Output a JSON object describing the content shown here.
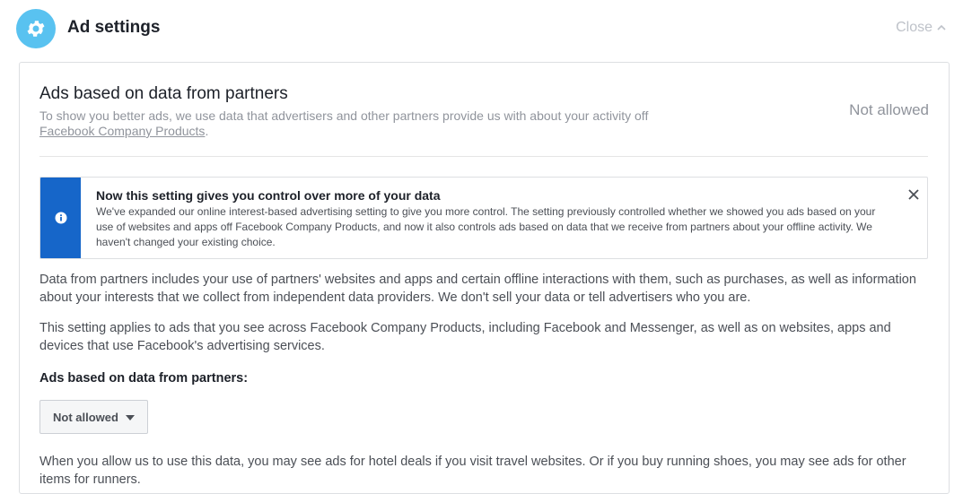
{
  "header": {
    "title": "Ad settings",
    "close_label": "Close",
    "accent_color": "#59c2f0"
  },
  "section": {
    "title": "Ads based on data from partners",
    "description_prefix": "To show you better ads, we use data that advertisers and other partners provide us with about your activity off",
    "description_link": "Facebook Company Products",
    "description_suffix": ".",
    "status": "Not allowed"
  },
  "notice": {
    "title": "Now this setting gives you control over more of your data",
    "body": "We've expanded our online interest-based advertising setting to give you more control. The setting previously controlled whether we showed you ads based on your use of websites and apps off Facebook Company Products, and now it also controls ads based on data that we receive from partners about your offline activity. We haven't changed your existing choice.",
    "strip_color": "#1666c9",
    "icon": "info-icon"
  },
  "paragraphs": {
    "p1": "Data from partners includes your use of partners' websites and apps and certain offline interactions with them, such as purchases, as well as information about your interests that we collect from independent data providers. We don't sell your data or tell advertisers who you are.",
    "p2": "This setting applies to ads that you see across Facebook Company Products, including Facebook and Messenger, as well as on websites, apps and devices that use Facebook's advertising services.",
    "p3": "When you allow us to use this data, you may see ads for hotel deals if you visit travel websites. Or if you buy running shoes, you may see ads for other items for runners."
  },
  "setting": {
    "label": "Ads based on data from partners:",
    "selected_value": "Not allowed"
  }
}
